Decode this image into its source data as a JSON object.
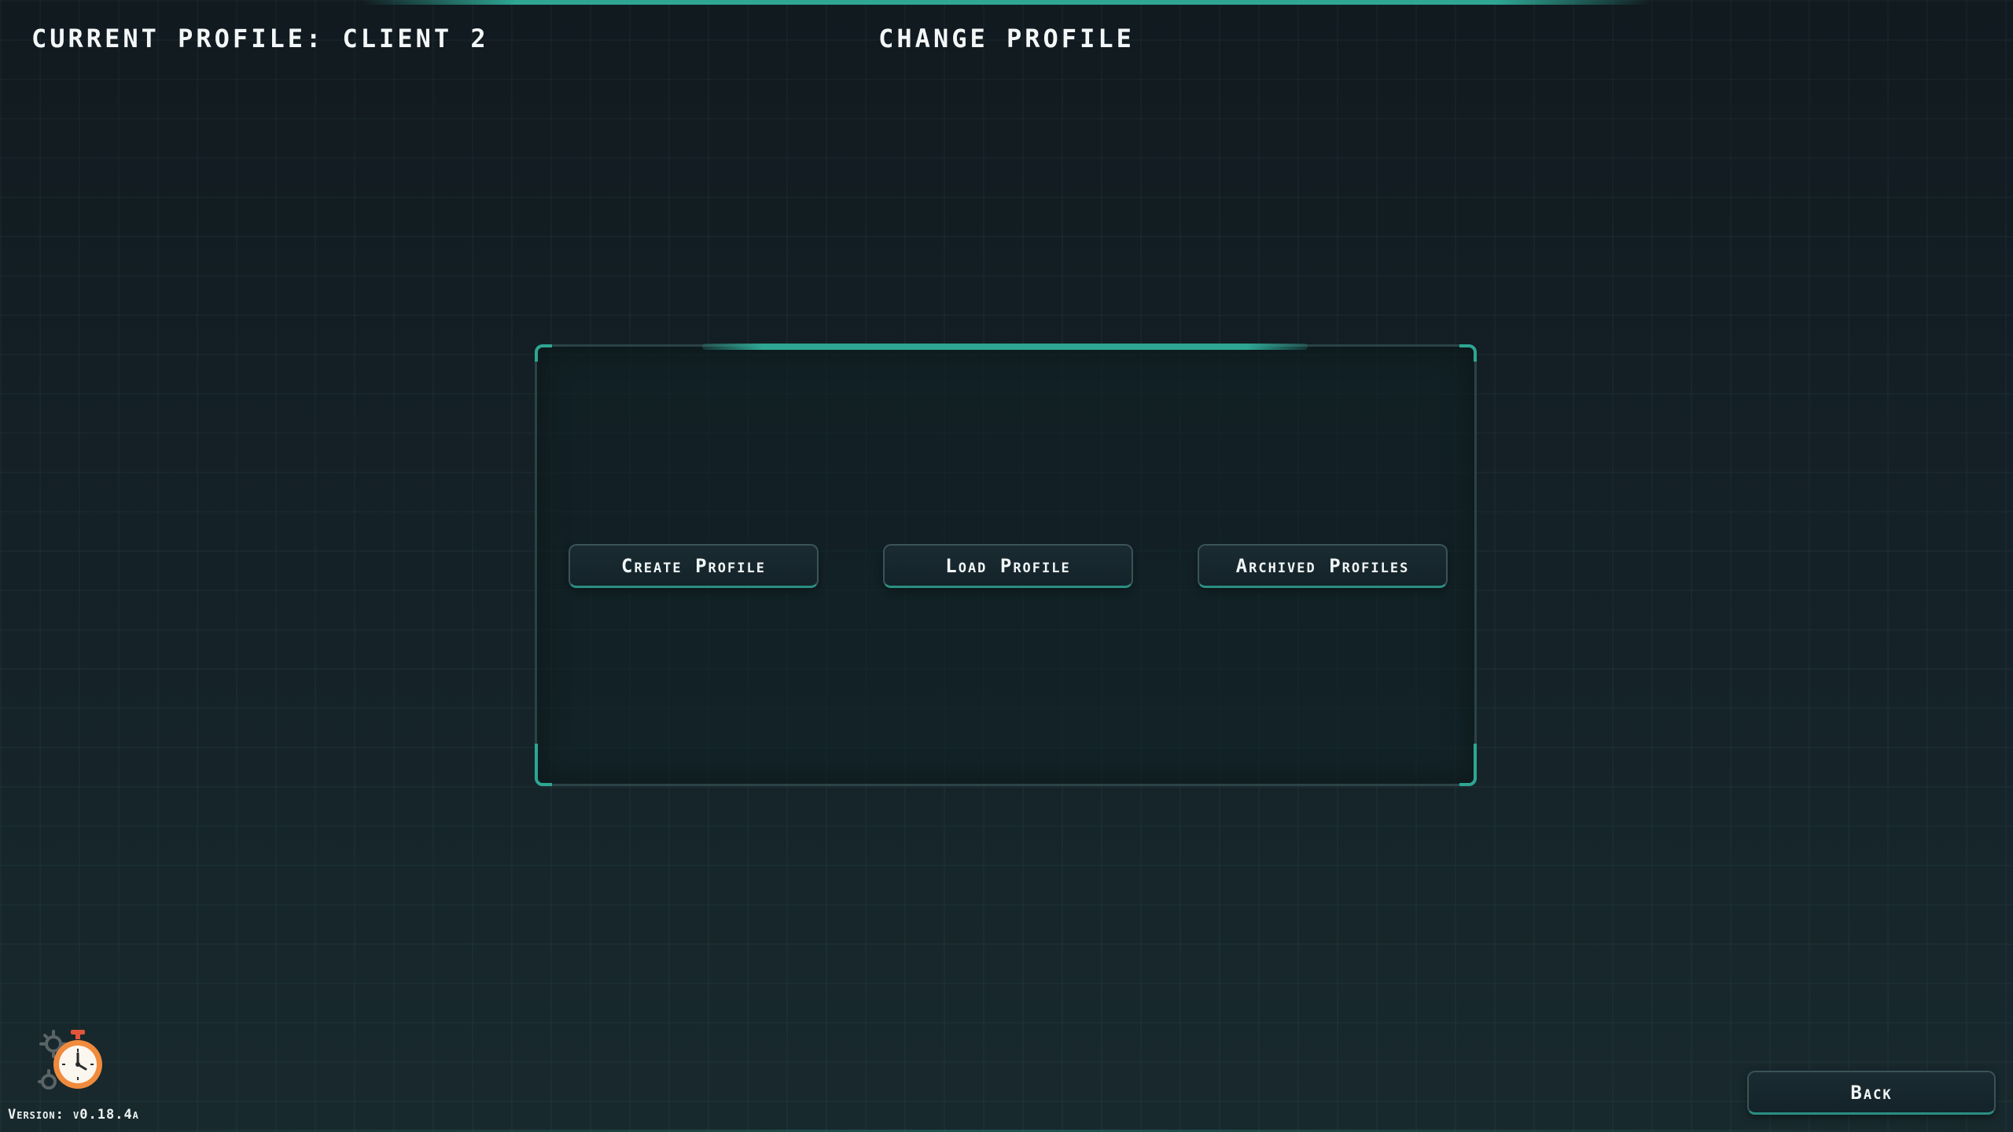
{
  "header": {
    "current_profile": "Current Profile: Client 2",
    "screen_title": "Change Profile"
  },
  "panel": {
    "buttons": {
      "create": "Create Profile",
      "load": "Load Profile",
      "archived": "Archived Profiles"
    }
  },
  "footer": {
    "back": "Back",
    "version": "Version: v0.18.4a",
    "logo_icon": "stopwatch-gears-icon"
  },
  "colors": {
    "accent": "#2ea693",
    "background": "#142127",
    "logo_orange": "#f08a3c"
  }
}
